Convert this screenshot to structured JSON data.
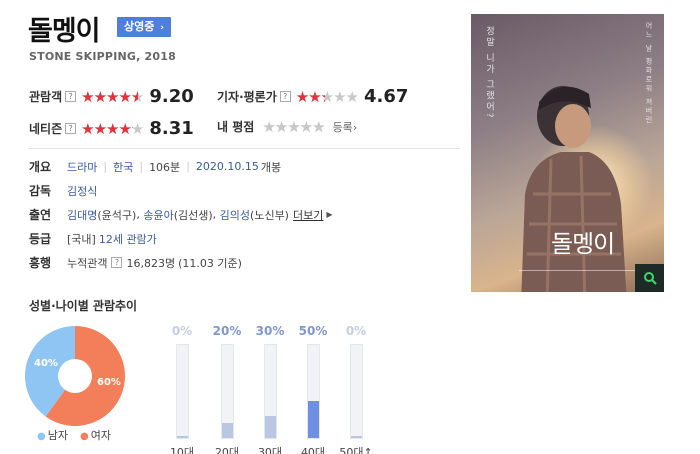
{
  "movie": {
    "title": "돌멩이",
    "status_badge": "상영중",
    "subtitle": "STONE SKIPPING, 2018"
  },
  "ratings": {
    "audience": {
      "label": "관람객",
      "score": "9.20",
      "fill": 0.92
    },
    "critic": {
      "label": "기자·평론가",
      "score": "4.67",
      "fill": 0.467
    },
    "netizen": {
      "label": "네티즌",
      "score": "8.31",
      "fill": 0.831
    },
    "my": {
      "label": "내 평점",
      "action": "등록",
      "fill": 1.0
    },
    "help_icon_text": "?"
  },
  "info": {
    "overview": {
      "label": "개요",
      "genre": "드라마",
      "country": "한국",
      "runtime": "106분",
      "release_date": "2020.10.15",
      "release_suffix": "개봉"
    },
    "director": {
      "label": "감독",
      "name": "김정식"
    },
    "cast": {
      "label": "출연",
      "actors": [
        "김대명",
        "송윤아",
        "김의성"
      ],
      "roles": [
        "(윤석구)",
        "(김선생)",
        "(노신부)"
      ],
      "more": "더보기"
    },
    "rating": {
      "label": "등급",
      "prefix": "[국내]",
      "value": "12세 관람가"
    },
    "box_office": {
      "label": "흥행",
      "prefix": "누적관객",
      "value": "16,823명",
      "note": "(11.03 기준)"
    }
  },
  "poster": {
    "title_text": "돌멩이",
    "tagline_left": "정말 니가 그랬어?",
    "tagline_right": "어느 날 평화로워 져버린"
  },
  "demographics": {
    "section_title": "성별·나이별 관람추이",
    "gender": [
      {
        "label": "남자",
        "percent_text": "40%",
        "value": 40,
        "color": "#8fc5f3"
      },
      {
        "label": "여자",
        "percent_text": "60%",
        "value": 60,
        "color": "#f37f5a"
      }
    ],
    "age": [
      {
        "label": "10대",
        "percent_text": "0%",
        "value": 0
      },
      {
        "label": "20대",
        "percent_text": "20%",
        "value": 20
      },
      {
        "label": "30대",
        "percent_text": "30%",
        "value": 30
      },
      {
        "label": "40대",
        "percent_text": "50%",
        "value": 50,
        "highlight": true
      },
      {
        "label": "50대↑",
        "percent_text": "0%",
        "value": 0
      }
    ]
  },
  "colors": {
    "accent": "#4f7fdb",
    "star_red": "#e1333c",
    "link_blue": "#3a5a9b"
  }
}
